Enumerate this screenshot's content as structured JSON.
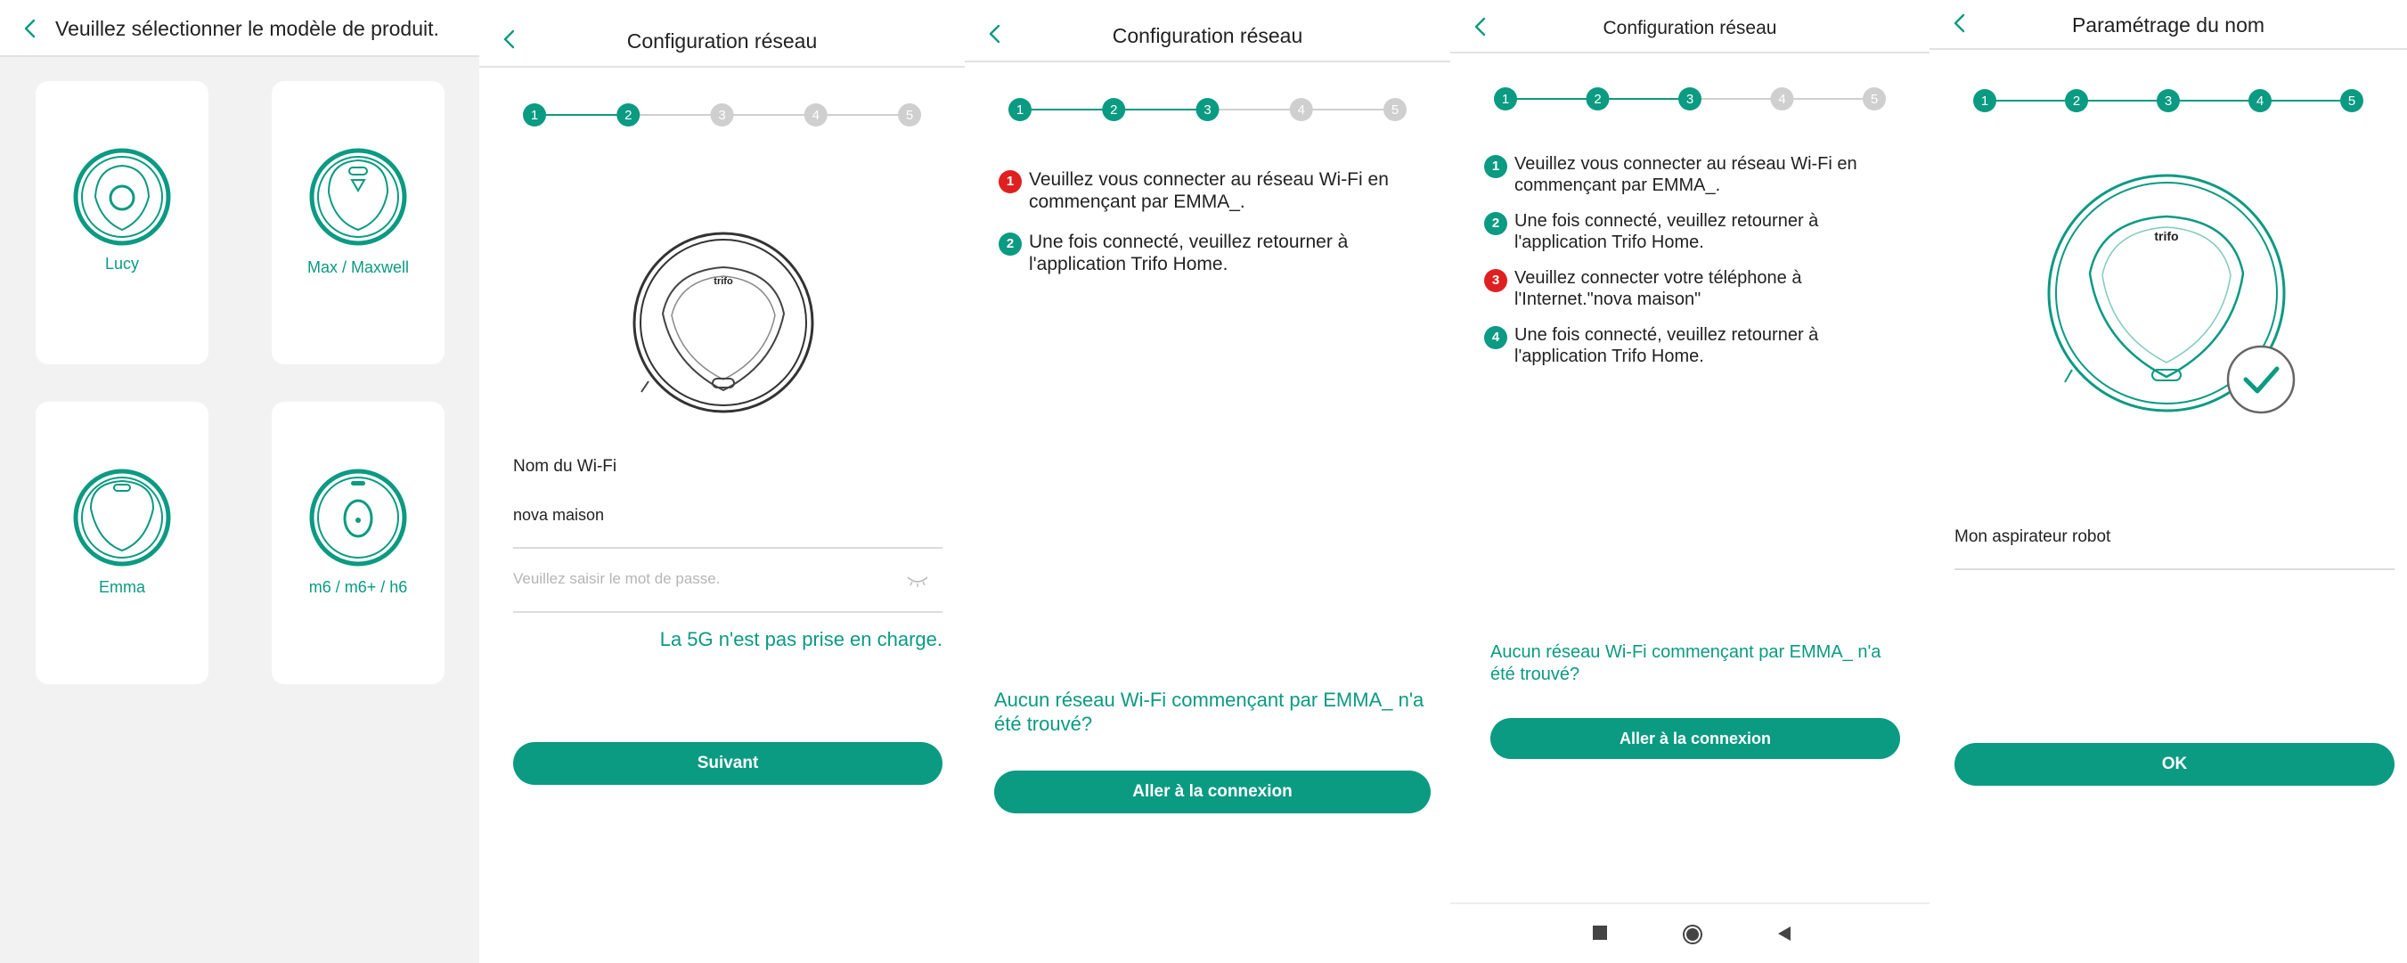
{
  "colors": {
    "accent": "#0b9a82",
    "alert": "#e02020",
    "inactive": "#cfcfcf"
  },
  "icons": {
    "back": "chevron-left-icon",
    "robot": "robot-vacuum-icon",
    "eye": "eye-closed-icon",
    "check": "checkmark-icon",
    "nav_recent": "square-icon",
    "nav_home": "circle-icon",
    "nav_back": "triangle-left-icon"
  },
  "screen1": {
    "title": "Veuillez sélectionner le modèle de produit.",
    "models": [
      {
        "label": "Lucy"
      },
      {
        "label": "Max / Maxwell"
      },
      {
        "label": "Emma"
      },
      {
        "label": "m6 / m6+ / h6"
      }
    ]
  },
  "screen2": {
    "title": "Configuration réseau",
    "steps": [
      "1",
      "2",
      "3",
      "4",
      "5"
    ],
    "active_steps": 2,
    "robot_brand": "trifo",
    "wifi_label": "Nom du Wi-Fi",
    "wifi_value": "nova maison",
    "password_placeholder": "Veuillez saisir le mot de passe.",
    "note_5g": "La 5G n'est pas prise en charge.",
    "next_button": "Suivant"
  },
  "screen3": {
    "title": "Configuration réseau",
    "steps": [
      "1",
      "2",
      "3",
      "4",
      "5"
    ],
    "active_steps": 3,
    "instructions": [
      {
        "num": "1",
        "alert": true,
        "text": "Veuillez vous connecter au réseau Wi-Fi en commençant par EMMA_."
      },
      {
        "num": "2",
        "alert": false,
        "text": "Une fois connecté, veuillez retourner à l'application Trifo Home."
      }
    ],
    "not_found_link": "Aucun réseau Wi-Fi commençant par EMMA_ n'a été trouvé?",
    "connect_button": "Aller à la connexion"
  },
  "screen4": {
    "title": "Configuration réseau",
    "steps": [
      "1",
      "2",
      "3",
      "4",
      "5"
    ],
    "active_steps": 3,
    "instructions": [
      {
        "num": "1",
        "alert": false,
        "text": "Veuillez vous connecter au réseau Wi-Fi en commençant par EMMA_."
      },
      {
        "num": "2",
        "alert": false,
        "text": "Une fois connecté, veuillez retourner à l'application Trifo Home."
      },
      {
        "num": "3",
        "alert": true,
        "text": "Veuillez connecter votre téléphone à l'Internet.\"nova maison\""
      },
      {
        "num": "4",
        "alert": false,
        "text": "Une fois connecté, veuillez retourner à l'application Trifo Home."
      }
    ],
    "not_found_link": "Aucun réseau Wi-Fi commençant par EMMA_ n'a été trouvé?",
    "connect_button": "Aller à la connexion"
  },
  "screen5": {
    "title": "Paramétrage du nom",
    "steps": [
      "1",
      "2",
      "3",
      "4",
      "5"
    ],
    "active_steps": 5,
    "robot_brand": "trifo",
    "name_value": "Mon aspirateur robot",
    "ok_button": "OK"
  }
}
